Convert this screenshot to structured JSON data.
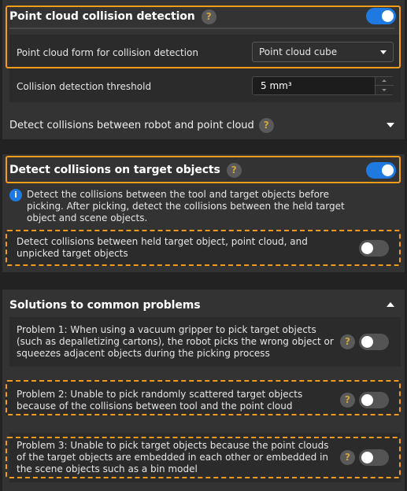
{
  "section1": {
    "title": "Point cloud collision detection",
    "help": "?",
    "enabled": true,
    "form_label": "Point cloud form for collision detection",
    "form_value": "Point cloud cube",
    "threshold_label": "Collision detection threshold",
    "threshold_value": "5 mm³",
    "robot_collision_label": "Detect collisions between robot and point cloud",
    "robot_collision_help": "?"
  },
  "section2": {
    "title": "Detect collisions on target objects",
    "help": "?",
    "enabled": true,
    "info_text": "Detect the collisions between the tool and target objects before picking. After picking, detect the collisions between the held target object and scene objects.",
    "held_object_label": "Detect collisions between held target object, point cloud, and unpicked target objects",
    "held_object_enabled": false
  },
  "section3": {
    "title": "Solutions to common problems",
    "problems": [
      {
        "label": "Problem 1: When using a vacuum gripper to pick target objects (such as depalletizing cartons), the robot picks the wrong object or squeezes adjacent objects during the picking process",
        "help": "?",
        "enabled": false
      },
      {
        "label": "Problem 2: Unable to pick randomly scattered target objects because of the collisions between tool and the point cloud",
        "help": "?",
        "enabled": false
      },
      {
        "label": "Problem 3: Unable to pick target objects because the point clouds of the target objects are embedded in each other or embedded in the scene objects such as a bin model",
        "help": "?",
        "enabled": false
      }
    ]
  },
  "colors": {
    "accent_orange": "#f29b1d",
    "toggle_on": "#1e7ae0",
    "toggle_off": "#545454",
    "info_blue": "#1e7ae0",
    "help_mark": "#d3a43b"
  }
}
